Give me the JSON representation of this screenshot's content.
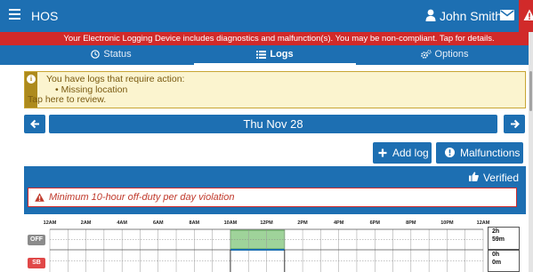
{
  "app": {
    "title": "HOS",
    "user_name": "John Smith"
  },
  "icons": {
    "menu": "hamburger-icon",
    "user": "user-icon",
    "mail": "envelope-icon",
    "alert": "warning-triangle-icon",
    "status": "clock-icon",
    "logs": "list-icon",
    "options": "cogs-icon",
    "notice": "info-circle-icon",
    "prev": "arrow-left-icon",
    "next": "arrow-right-icon",
    "add": "plus-icon",
    "malfunctions": "exclamation-circle-icon",
    "verified": "thumbs-up-icon",
    "violation": "warning-triangle-icon"
  },
  "banner": {
    "text": "Your Electronic Logging Device includes diagnostics and malfunction(s). You may be non-compliant. Tap for details."
  },
  "tabs": {
    "status": "Status",
    "logs": "Logs",
    "options": "Options"
  },
  "notice": {
    "title": "You have logs that require action:",
    "item": "• Missing location",
    "footer": "Tap here to review."
  },
  "date": {
    "label": "Thu Nov 28"
  },
  "actions": {
    "add_log": "Add log",
    "malfunctions": "Malfunctions"
  },
  "log": {
    "verified": "Verified",
    "violation": "Minimum 10-hour off-duty per day violation",
    "hours": [
      "12AM",
      "2AM",
      "4AM",
      "6AM",
      "8AM",
      "10AM",
      "12PM",
      "2PM",
      "4PM",
      "6PM",
      "8PM",
      "10PM",
      "12AM"
    ],
    "rows": {
      "off": "OFF",
      "sb": "SB"
    },
    "totals": {
      "off": [
        "2h",
        "59m"
      ],
      "sb": [
        "0h",
        "0m"
      ]
    },
    "colors": {
      "primary": "#1d6fb2",
      "alert": "#d12a2a",
      "off_period": "#9fd39a",
      "sb_row": "#e04848"
    }
  }
}
